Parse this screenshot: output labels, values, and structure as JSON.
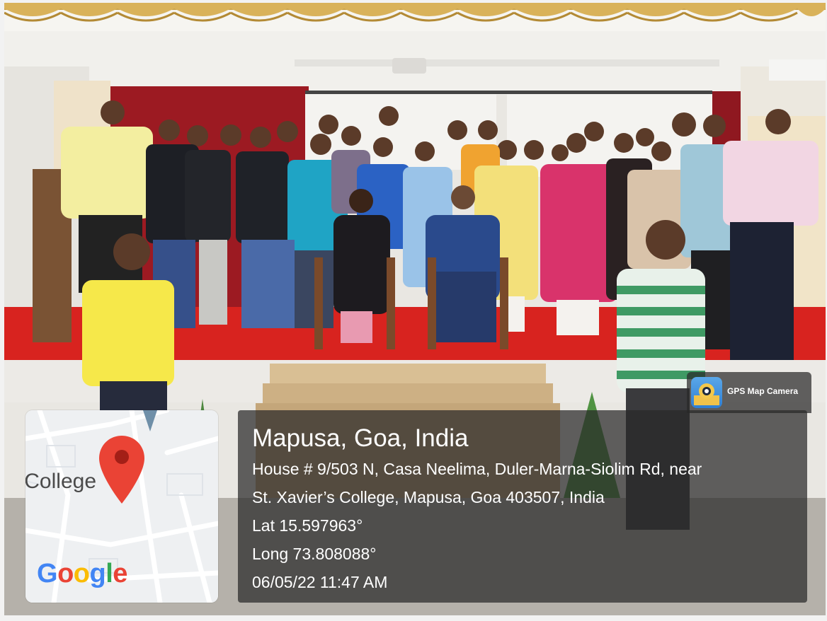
{
  "overlay": {
    "app_label": "GPS Map Camera",
    "map": {
      "place_label": "College",
      "provider_logo": [
        "G",
        "o",
        "o",
        "g",
        "l",
        "e"
      ],
      "pin_color": "#ea4335"
    },
    "location": {
      "title": "Mapusa, Goa, India",
      "address_line1": "House # 9/503 N, Casa Neelima, Duler-Marna-Siolim Rd, near",
      "address_line2": "St. Xavier’s College, Mapusa, Goa 403507, India",
      "latitude": "Lat 15.597963°",
      "longitude": "Long 73.808088°",
      "datetime": "06/05/22 11:47 AM"
    }
  },
  "photo": {
    "scene": "group photo on stage",
    "stage_color": "#d8231f",
    "curtain_color": "#9c1a22"
  }
}
